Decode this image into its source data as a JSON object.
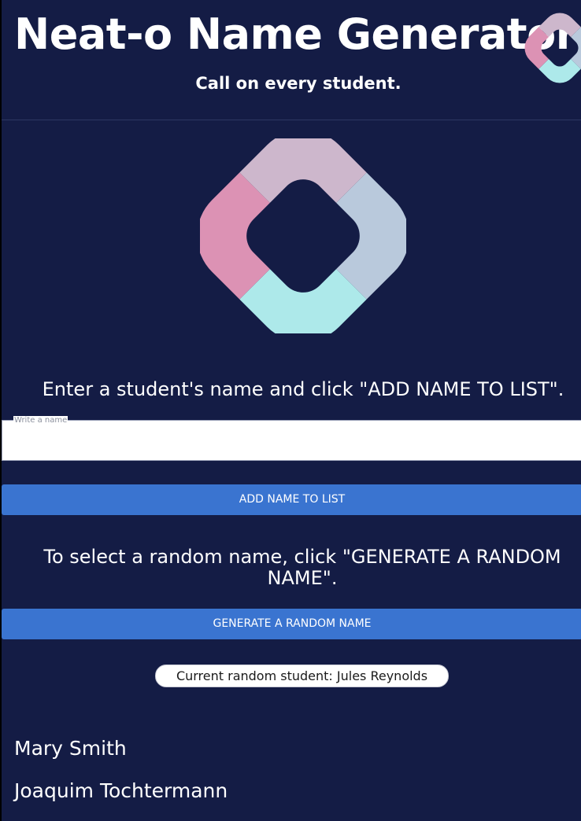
{
  "header": {
    "title": "Neat-o Name Generator",
    "subtitle": "Call on every student."
  },
  "logo": {
    "icon": "rounded-square-ring-logo",
    "colors": {
      "pink": "#dc92b4",
      "mauve": "#cdb7cc",
      "slate": "#b9c9dc",
      "cyan": "#ade9ea"
    }
  },
  "add_section": {
    "instruction": "Enter a student's name and click \"ADD NAME TO LIST\".",
    "input_label": "Write a name",
    "input_value": "",
    "button_label": "ADD NAME TO LIST"
  },
  "random_section": {
    "instruction": "To select a random name, click \"GENERATE A RANDOM NAME\".",
    "button_label": "GENERATE A RANDOM NAME",
    "current_text": "Current random student: Jules Reynolds"
  },
  "names": [
    "Mary Smith",
    "Joaquim Tochtermann"
  ],
  "theme": {
    "background": "#141c45",
    "button": "#3a74d0"
  }
}
